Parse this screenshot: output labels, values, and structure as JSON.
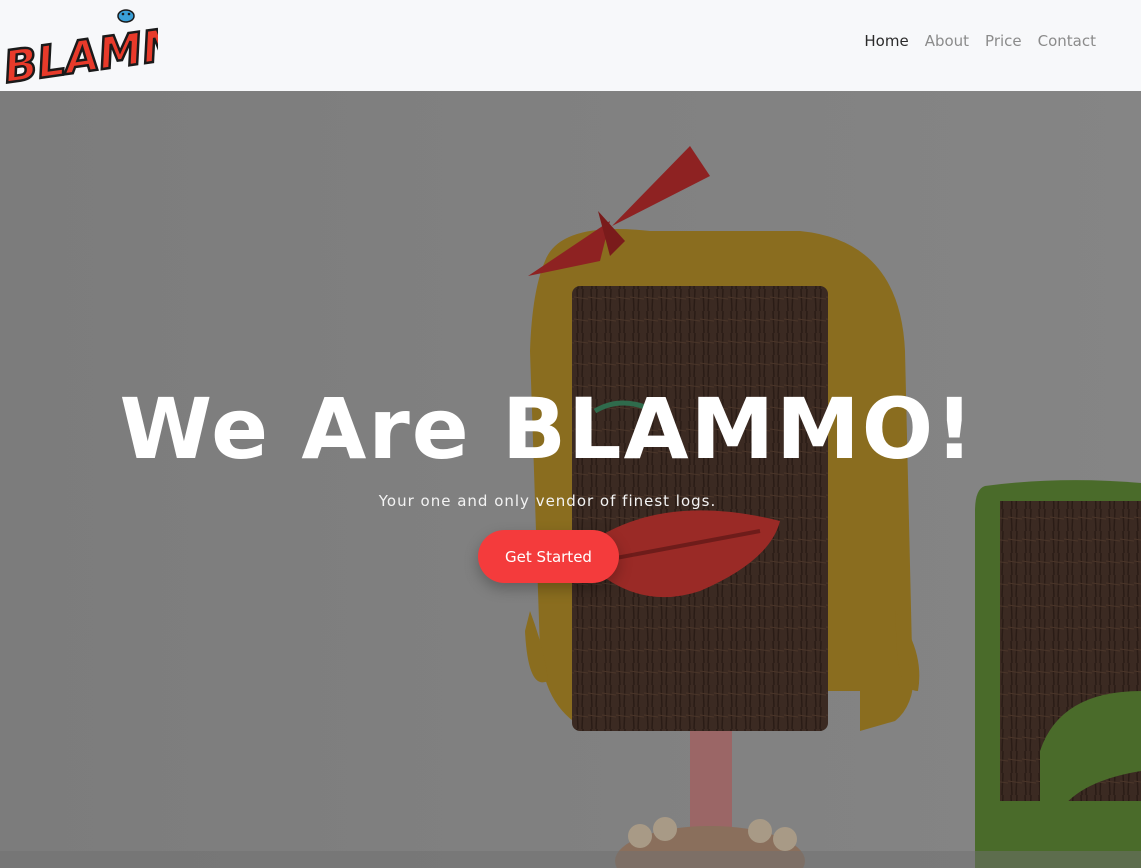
{
  "brand": {
    "logo_text": "BLAMMO!"
  },
  "nav": {
    "items": [
      {
        "label": "Home",
        "active": true
      },
      {
        "label": "About",
        "active": false
      },
      {
        "label": "Price",
        "active": false
      },
      {
        "label": "Contact",
        "active": false
      }
    ]
  },
  "hero": {
    "title": "We Are BLAMMO!",
    "subtitle": "Your one and only vendor of finest logs.",
    "cta_label": "Get Started"
  },
  "colors": {
    "accent": "#f43b3c",
    "navbar_bg": "#f7f8fa",
    "nav_active": "#2a2a2a",
    "nav_inactive": "#8b8b8b"
  }
}
